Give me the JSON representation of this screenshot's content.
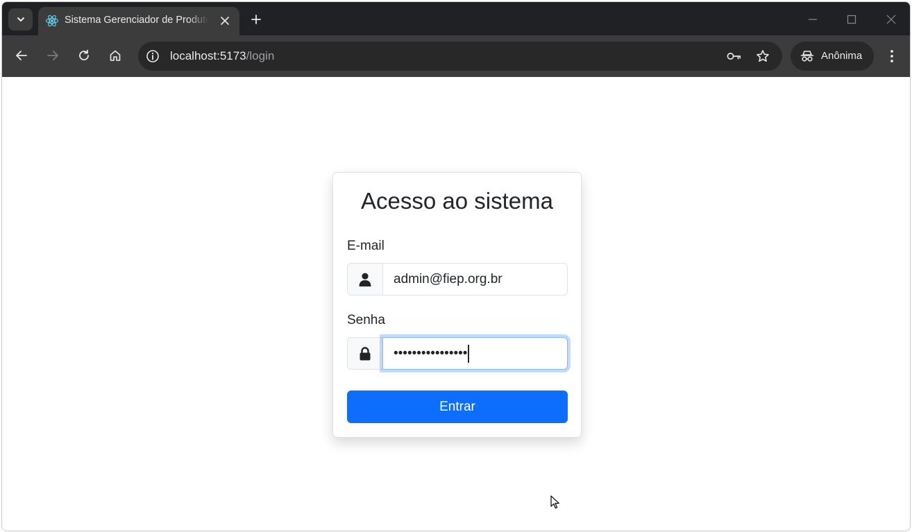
{
  "browser": {
    "tab": {
      "title": "Sistema Gerenciador de Produtos",
      "favicon": "react-icon"
    },
    "address_bar": {
      "host": "localhost:5173",
      "path": "/login"
    },
    "profile": {
      "label": "Anônima",
      "icon": "incognito-icon"
    },
    "colors": {
      "frame": "#202124",
      "toolbar": "#3c3c3c",
      "omnibox": "#282828"
    }
  },
  "login": {
    "title": "Acesso ao sistema",
    "email": {
      "label": "E-mail",
      "value": "admin@fiep.org.br",
      "icon": "user-icon"
    },
    "password": {
      "label": "Senha",
      "masked_value": "••••••••••••••••",
      "icon": "lock-icon"
    },
    "submit_label": "Entrar",
    "colors": {
      "primary": "#0d6efd",
      "focus_ring": "#86b7fe"
    }
  }
}
